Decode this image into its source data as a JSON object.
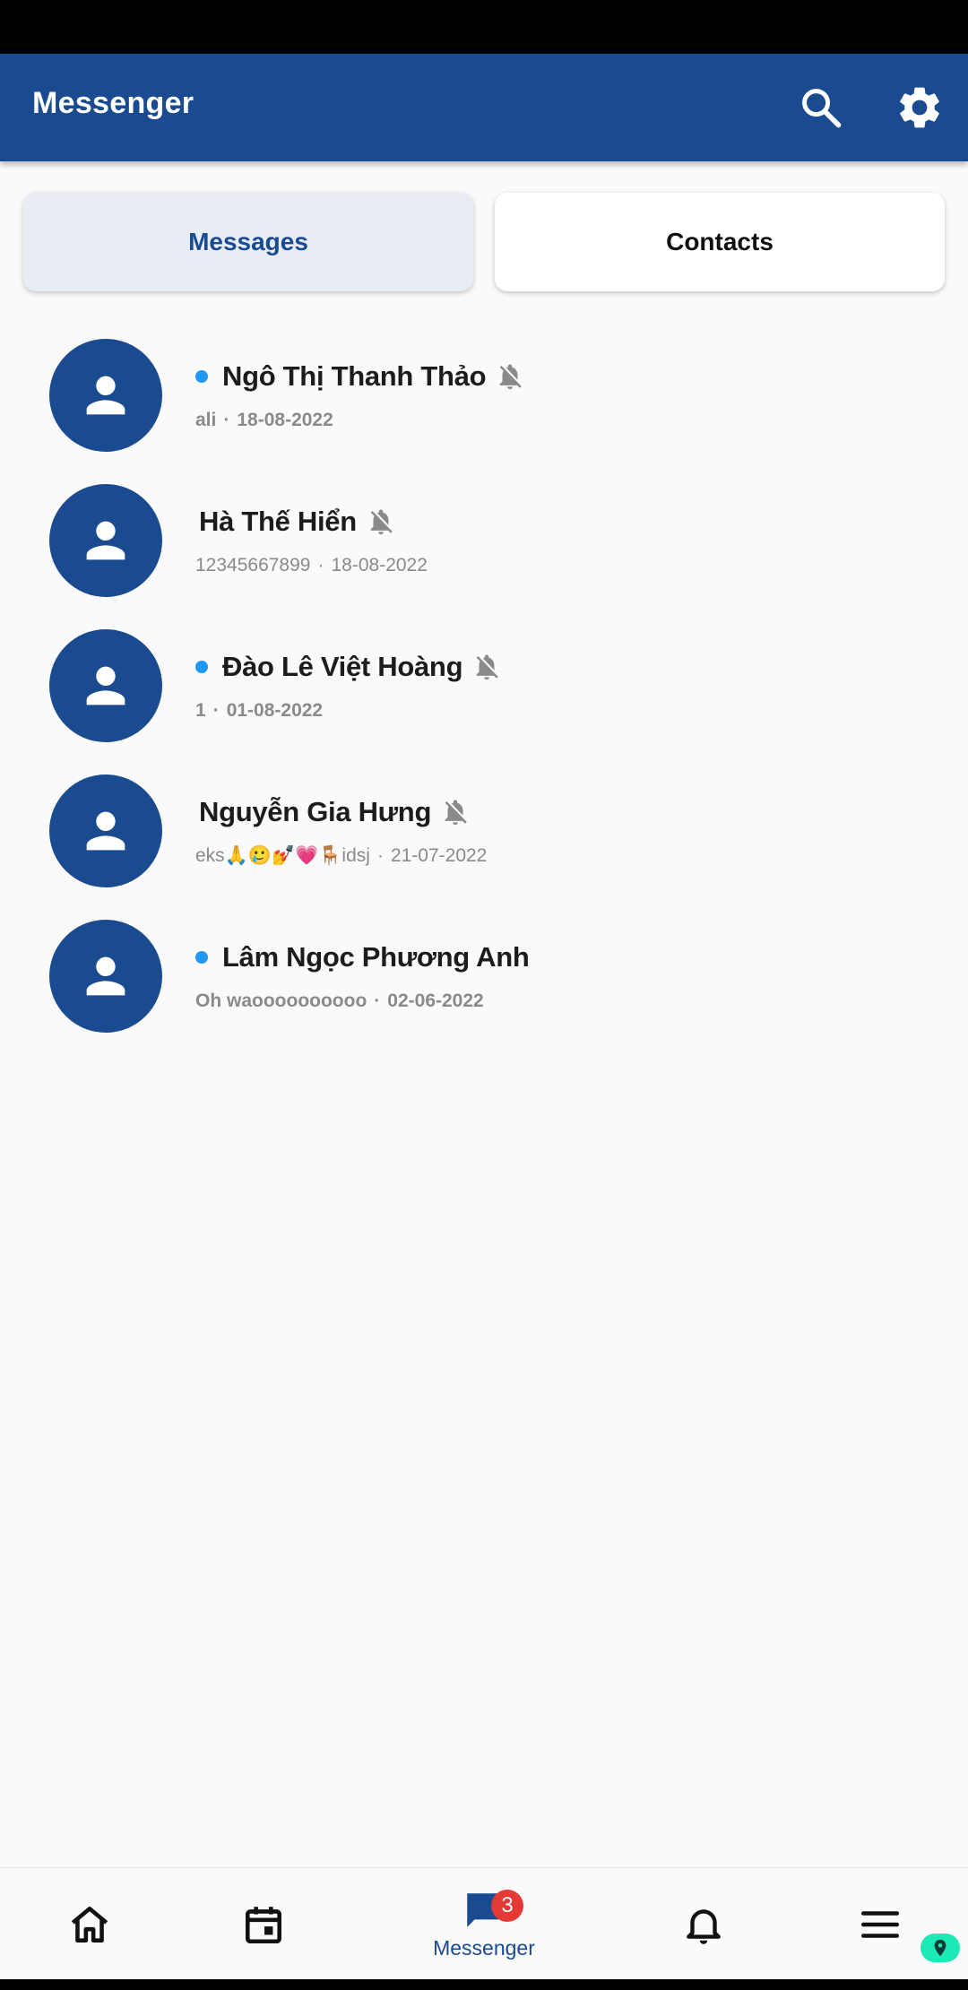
{
  "app_bar": {
    "title": "Messenger",
    "icons": [
      "search-icon",
      "settings-icon"
    ],
    "color": "#1a4a8f"
  },
  "tabs": [
    {
      "label": "Messages",
      "selected": true
    },
    {
      "label": "Contacts",
      "selected": false
    }
  ],
  "conversations": [
    {
      "name": "Ngô Thị Thanh Thảo",
      "preview": "ali",
      "date": "18-08-2022",
      "unread": true,
      "muted": true
    },
    {
      "name": "Hà Thế Hiển",
      "preview": "12345667899",
      "date": "18-08-2022",
      "unread": false,
      "muted": true
    },
    {
      "name": "Đào Lê Việt Hoàng",
      "preview": "1",
      "date": "01-08-2022",
      "unread": true,
      "muted": true
    },
    {
      "name": "Nguyễn Gia Hưng",
      "preview": "eks🙏🥲💅💗🪑idsj",
      "date": "21-07-2022",
      "unread": false,
      "muted": true
    },
    {
      "name": "Lâm Ngọc Phương Anh",
      "preview": "Oh waoooooooooo",
      "date": "02-06-2022",
      "unread": true,
      "muted": false
    }
  ],
  "separator": "·",
  "bottom_nav": {
    "items": [
      "home-icon",
      "calendar-icon",
      "messenger-icon",
      "bell-icon",
      "menu-icon"
    ],
    "active_label": "Messenger",
    "badge_count": "3"
  },
  "colors": {
    "unread_dot": "#2196f3",
    "badge": "#e53935",
    "pin_fab": "#1de9b6"
  }
}
